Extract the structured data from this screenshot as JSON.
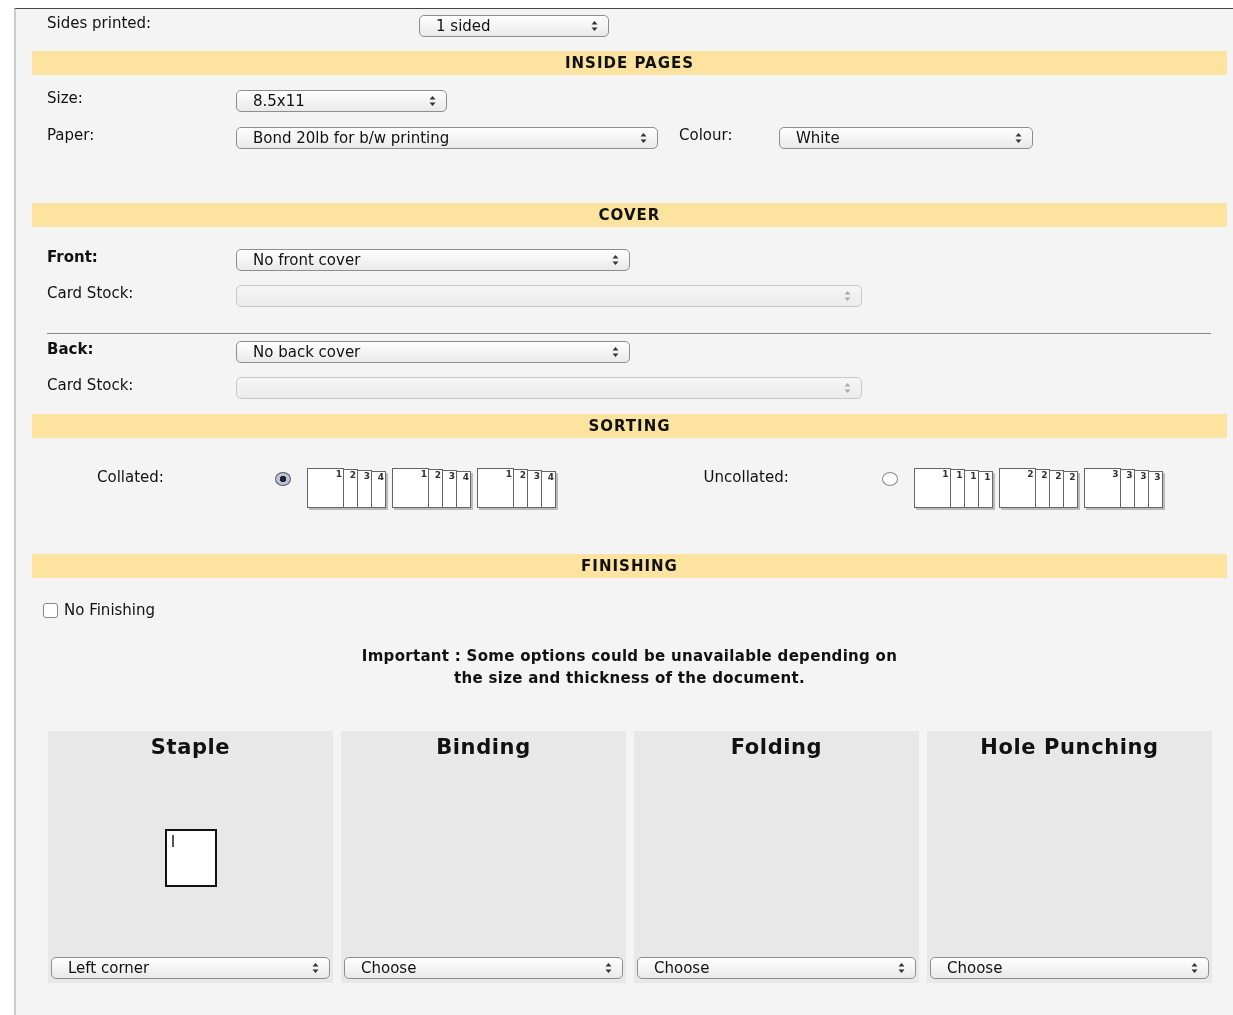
{
  "sides_printed": {
    "label": "Sides printed:",
    "value": "1 sided"
  },
  "inside_pages": {
    "title": "INSIDE PAGES",
    "size": {
      "label": "Size:",
      "value": "8.5x11"
    },
    "paper": {
      "label": "Paper:",
      "value": "Bond 20lb for b/w printing"
    },
    "colour": {
      "label": "Colour:",
      "value": "White"
    }
  },
  "cover": {
    "title": "COVER",
    "parts": [
      {
        "label": "Front:",
        "value": "No front cover",
        "card_stock": {
          "label": "Card Stock:",
          "disabled": true
        }
      },
      {
        "label": "Back:",
        "value": "No back cover",
        "card_stock": {
          "label": "Card Stock:",
          "disabled": true
        }
      }
    ]
  },
  "sorting": {
    "title": "SORTING",
    "options": [
      {
        "label": "Collated:",
        "selected": true,
        "sets": [
          [
            "1",
            "2",
            "3",
            "4"
          ],
          [
            "1",
            "2",
            "3",
            "4"
          ],
          [
            "1",
            "2",
            "3",
            "4"
          ]
        ]
      },
      {
        "label": "Uncollated:",
        "selected": false,
        "sets": [
          [
            "1",
            "1",
            "1",
            "1"
          ],
          [
            "2",
            "2",
            "2",
            "2"
          ],
          [
            "3",
            "3",
            "3",
            "3"
          ]
        ]
      }
    ]
  },
  "finishing": {
    "title": "FINISHING",
    "no_finishing": {
      "label": "No Finishing",
      "checked": false
    },
    "notice": [
      "Important : Some options could be unavailable depending on",
      "the size and thickness of the document."
    ],
    "options": [
      {
        "kind": "staple",
        "title": "Staple",
        "value": "Left corner"
      },
      {
        "kind": "plain",
        "title": "Binding",
        "value": "Choose"
      },
      {
        "kind": "plain",
        "title": "Folding",
        "value": "Choose"
      },
      {
        "kind": "plain",
        "title": "Hole Punching",
        "value": "Choose"
      }
    ]
  }
}
